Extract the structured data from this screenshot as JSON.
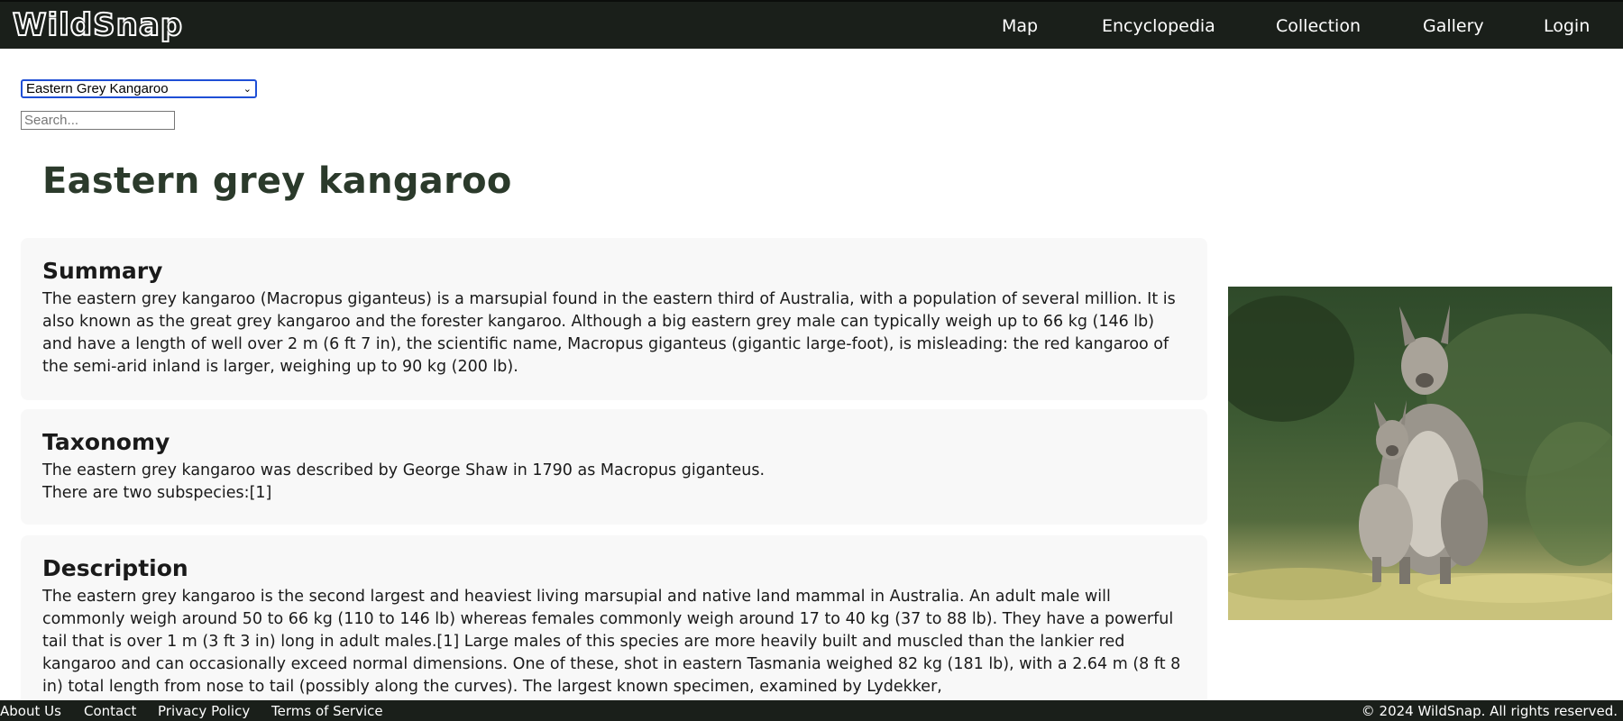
{
  "header": {
    "logo": "WildSnap",
    "nav": [
      "Map",
      "Encyclopedia",
      "Collection",
      "Gallery",
      "Login"
    ]
  },
  "controls": {
    "species_selected": "Eastern Grey Kangaroo",
    "search_placeholder": "Search..."
  },
  "page_title": "Eastern grey kangaroo",
  "sections": {
    "summary": {
      "heading": "Summary",
      "text": "The eastern grey kangaroo (Macropus giganteus) is a marsupial found in the eastern third of Australia, with a population of several million. It is also known as the great grey kangaroo and the forester kangaroo. Although a big eastern grey male can typically weigh up to 66 kg (146 lb) and have a length of well over 2 m (6 ft 7 in), the scientific name, Macropus giganteus (gigantic large-foot), is misleading: the red kangaroo of the semi-arid inland is larger, weighing up to 90 kg (200 lb)."
    },
    "taxonomy": {
      "heading": "Taxonomy",
      "line1": "The eastern grey kangaroo was described by George Shaw in 1790 as Macropus giganteus.",
      "line2": "There are two subspecies:[1]"
    },
    "description": {
      "heading": "Description",
      "text": "The eastern grey kangaroo is the second largest and heaviest living marsupial and native land mammal in Australia. An adult male will commonly weigh around 50 to 66 kg (110 to 146 lb) whereas females commonly weigh around 17 to 40 kg (37 to 88 lb). They have a powerful tail that is over 1 m (3 ft 3 in) long in adult males.[1] Large males of this species are more heavily built and muscled than the lankier red kangaroo and can occasionally exceed normal dimensions. One of these, shot in eastern Tasmania weighed 82 kg (181 lb), with a 2.64 m (8 ft 8 in) total length from nose to tail (possibly along the curves). The largest known specimen, examined by Lydekker,"
    }
  },
  "footer": {
    "links": [
      "About Us",
      "Contact",
      "Privacy Policy",
      "Terms of Service"
    ],
    "copyright": "© 2024 WildSnap. All rights reserved."
  },
  "icons": {
    "dropdown": "chevron-down-icon"
  },
  "colors": {
    "topbar": "#1a1f1a",
    "title": "#2b3a2b",
    "card_bg": "#f8f8f8",
    "select_focus": "#1f4fd6"
  }
}
